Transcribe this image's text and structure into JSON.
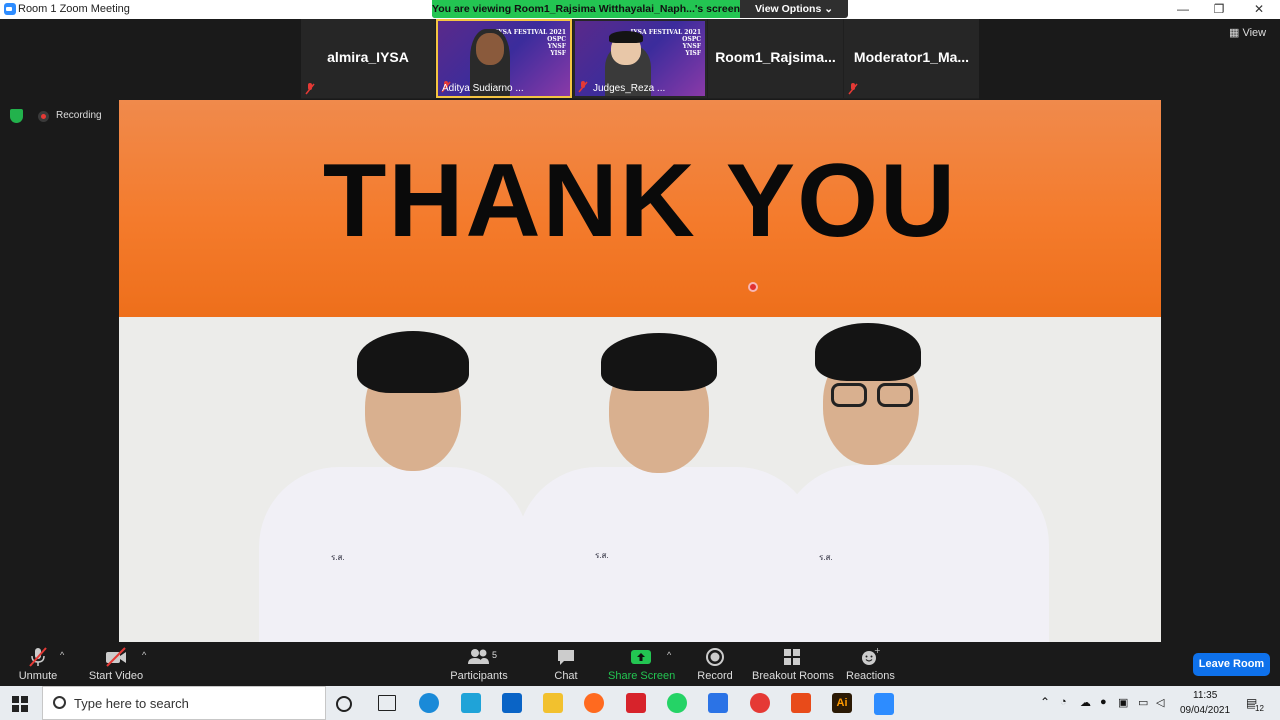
{
  "window": {
    "title": "Room 1   Zoom Meeting",
    "minimize": "—",
    "restore": "❐",
    "close": "✕"
  },
  "banner": {
    "viewing_text": "You are viewing Room1_Rajsima Witthayalai_Naph...'s screen",
    "view_options": "View Options ⌄"
  },
  "participants_strip": [
    {
      "name": "almira_IYSA",
      "muted": true,
      "video": false
    },
    {
      "name": "Aditya Sudiarno ...",
      "video": true
    },
    {
      "name": "Judges_Reza ...",
      "video": true
    },
    {
      "name": "Room1_Rajsima...",
      "muted": false,
      "video": false
    },
    {
      "name": "Moderator1_Ma...",
      "muted": true,
      "video": false
    }
  ],
  "festival_text": [
    "IYSA FESTIVAL 2021",
    "OSPC",
    "YNSF",
    "YISF"
  ],
  "view_button": "View",
  "recording": {
    "label": "Recording"
  },
  "shared_screen": {
    "headline": "THANK YOU",
    "shirt_badges": [
      "ร.ส.",
      "ร.ส.",
      "ร.ส."
    ]
  },
  "toolbar": {
    "unmute": "Unmute",
    "start_video": "Start Video",
    "participants": "Participants",
    "participants_count": "5",
    "chat": "Chat",
    "share_screen": "Share Screen",
    "record": "Record",
    "breakout_rooms": "Breakout Rooms",
    "reactions": "Reactions",
    "leave_room": "Leave Room",
    "caret": "^"
  },
  "taskbar": {
    "search_placeholder": "Type here to search",
    "time": "11:35",
    "date": "09/04/2021",
    "notification_count": "12",
    "apps": [
      "cortana",
      "task-view",
      "edge",
      "l-app",
      "mail",
      "file-explorer",
      "firefox",
      "acrobat",
      "whatsapp",
      "wps",
      "chrome",
      "office",
      "illustrator",
      "zoom"
    ],
    "app_colors": {
      "edge": "#1a8ad8",
      "l-app": "#1fa3d8",
      "mail": "#0a64c6",
      "file-explorer": "#f2c12e",
      "firefox": "#ff6a1f",
      "acrobat": "#d7232b",
      "whatsapp": "#25d366",
      "wps": "#2b73e6",
      "chrome": "#e53935",
      "office": "#e84b1a",
      "illustrator": "#2b1a05",
      "zoom": "#2d8cff"
    },
    "illustrator_label": "Ai"
  },
  "colors": {
    "zoom_blue": "#2d8cff",
    "share_green": "#23c552",
    "leave_blue": "#0e71eb",
    "slide_orange": "#f47b2c"
  }
}
